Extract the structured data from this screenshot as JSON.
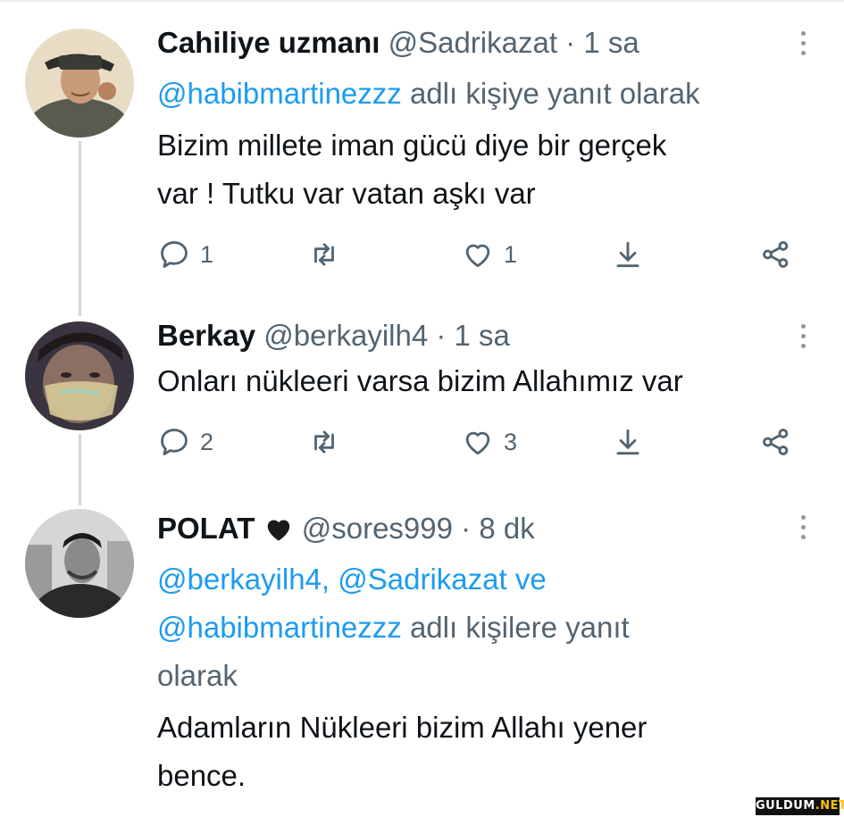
{
  "tweets": [
    {
      "name": "Cahiliye uzmanı",
      "handle": "@Sadrikazat",
      "sep": "·",
      "time": "1 sa",
      "reply_prefix": "",
      "reply_mentions": "@habibmartinezzz",
      "reply_suffix": " adlı kişiye yanıt olarak",
      "body_line1": "Bizim millete iman gücü diye bir gerçek",
      "body_line2": "var ! Tutku var vatan aşkı var",
      "reply_count": "1",
      "retweet_count": "",
      "like_count": "1"
    },
    {
      "name": "Berkay",
      "handle": "@berkayilh4",
      "sep": "·",
      "time": "1 sa",
      "body_line1": "Onları nükleeri varsa bizim Allahımız var",
      "reply_count": "2",
      "retweet_count": "",
      "like_count": "3"
    },
    {
      "name": "POLAT",
      "handle": "@sores999",
      "sep": "·",
      "time": "8 dk",
      "reply_mentions_line1": "@berkayilh4, @Sadrikazat ve",
      "reply_mentions_line2": "@habibmartinezzz",
      "reply_suffix_line2": " adlı kişilere yanıt",
      "reply_line3": "olarak",
      "body_line1": "Adamların Nükleeri bizim Allahı yener",
      "body_line2": "bence."
    }
  ],
  "icons": {
    "reply": "speech-bubble-icon",
    "retweet": "retweet-icon",
    "like": "heart-icon",
    "share": "download-arrow-icon",
    "more": "share-icon"
  },
  "colors": {
    "link": "#1d9bf0",
    "secondary": "#536471",
    "text": "#0f1419"
  },
  "watermark": {
    "text_a": "GULDUM",
    "text_b": ".NET"
  }
}
